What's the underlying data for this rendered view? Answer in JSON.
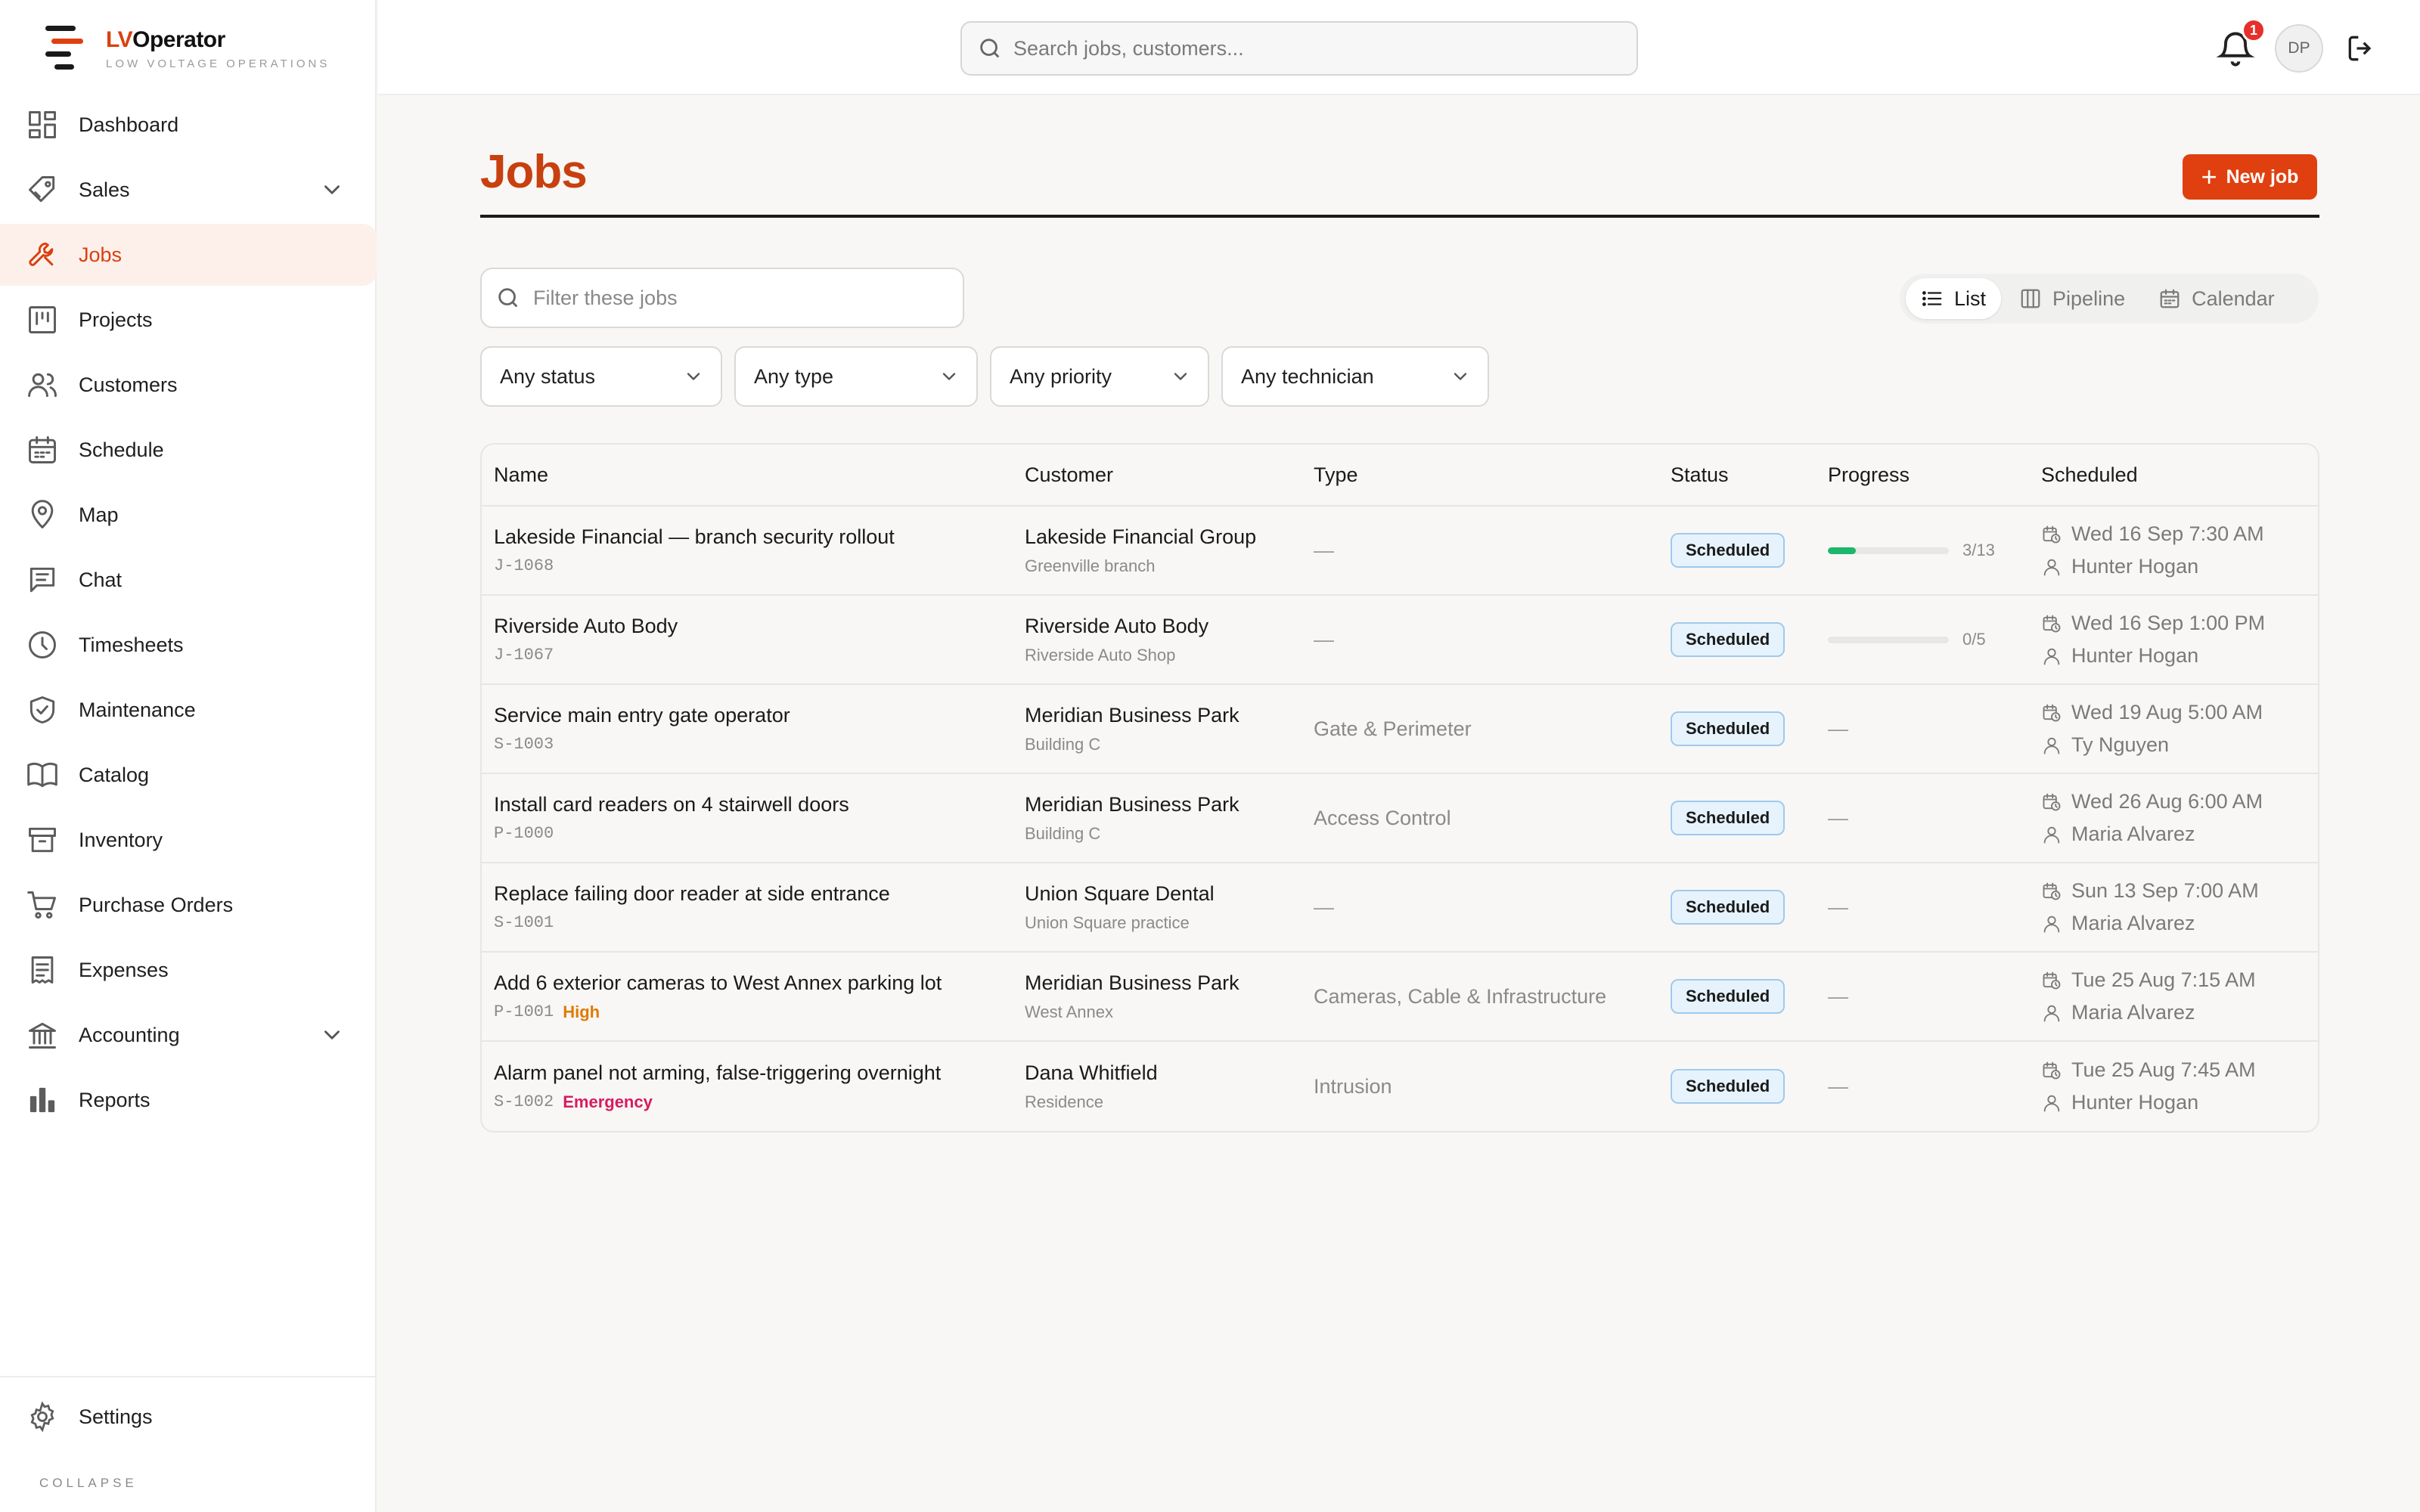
{
  "app": {
    "brand_lv": "LV",
    "brand_rest": "Operator",
    "tagline": "LOW VOLTAGE OPERATIONS"
  },
  "nav": [
    {
      "label": "Dashboard",
      "icon": "dashboard-icon"
    },
    {
      "label": "Sales",
      "icon": "tag-icon",
      "expandable": true
    },
    {
      "label": "Jobs",
      "icon": "wrench-icon",
      "active": true
    },
    {
      "label": "Projects",
      "icon": "kanban-icon"
    },
    {
      "label": "Customers",
      "icon": "users-icon"
    },
    {
      "label": "Schedule",
      "icon": "calendar-icon"
    },
    {
      "label": "Map",
      "icon": "map-pin-icon"
    },
    {
      "label": "Chat",
      "icon": "chat-icon"
    },
    {
      "label": "Timesheets",
      "icon": "clock-icon"
    },
    {
      "label": "Maintenance",
      "icon": "shield-check-icon"
    },
    {
      "label": "Catalog",
      "icon": "book-icon"
    },
    {
      "label": "Inventory",
      "icon": "archive-icon"
    },
    {
      "label": "Purchase Orders",
      "icon": "cart-icon"
    },
    {
      "label": "Expenses",
      "icon": "receipt-icon"
    },
    {
      "label": "Accounting",
      "icon": "bank-icon",
      "expandable": true
    },
    {
      "label": "Reports",
      "icon": "bar-chart-icon"
    }
  ],
  "sidebar_footer": {
    "settings_label": "Settings",
    "collapse_label": "COLLAPSE"
  },
  "topbar": {
    "search_placeholder": "Search jobs, customers...",
    "notification_count": "1",
    "avatar_initials": "DP"
  },
  "page": {
    "title": "Jobs",
    "new_job_label": "New job",
    "filter_placeholder": "Filter these jobs",
    "views": [
      {
        "label": "List",
        "icon": "list-icon",
        "active": true
      },
      {
        "label": "Pipeline",
        "icon": "columns-icon"
      },
      {
        "label": "Calendar",
        "icon": "calendar-icon"
      }
    ],
    "dropdowns": [
      {
        "label": "Any status"
      },
      {
        "label": "Any type"
      },
      {
        "label": "Any priority"
      },
      {
        "label": "Any technician"
      }
    ]
  },
  "table": {
    "columns": [
      "Name",
      "Customer",
      "Type",
      "Status",
      "Progress",
      "Scheduled"
    ],
    "rows": [
      {
        "name": "Lakeside Financial — branch security rollout",
        "code": "J-1068",
        "priority": "",
        "customer": "Lakeside Financial Group",
        "location": "Greenville branch",
        "type": "—",
        "status": "Scheduled",
        "progress": "3/13",
        "progress_fraction": 0.23,
        "date": "Wed 16 Sep 7:30 AM",
        "tech": "Hunter Hogan"
      },
      {
        "name": "Riverside Auto Body",
        "code": "J-1067",
        "priority": "",
        "customer": "Riverside Auto Body",
        "location": "Riverside Auto Shop",
        "type": "—",
        "status": "Scheduled",
        "progress": "0/5",
        "progress_fraction": 0,
        "date": "Wed 16 Sep 1:00 PM",
        "tech": "Hunter Hogan"
      },
      {
        "name": "Service main entry gate operator",
        "code": "S-1003",
        "priority": "",
        "customer": "Meridian Business Park",
        "location": "Building C",
        "type": "Gate & Perimeter",
        "status": "Scheduled",
        "progress": "—",
        "date": "Wed 19 Aug 5:00 AM",
        "tech": "Ty Nguyen"
      },
      {
        "name": "Install card readers on 4 stairwell doors",
        "code": "P-1000",
        "priority": "",
        "customer": "Meridian Business Park",
        "location": "Building C",
        "type": "Access Control",
        "status": "Scheduled",
        "progress": "—",
        "date": "Wed 26 Aug 6:00 AM",
        "tech": "Maria Alvarez"
      },
      {
        "name": "Replace failing door reader at side entrance",
        "code": "S-1001",
        "priority": "",
        "customer": "Union Square Dental",
        "location": "Union Square practice",
        "type": "—",
        "status": "Scheduled",
        "progress": "—",
        "date": "Sun 13 Sep 7:00 AM",
        "tech": "Maria Alvarez"
      },
      {
        "name": "Add 6 exterior cameras to West Annex parking lot",
        "code": "P-1001",
        "priority": "High",
        "customer": "Meridian Business Park",
        "location": "West Annex",
        "type": "Cameras, Cable & Infrastructure",
        "status": "Scheduled",
        "progress": "—",
        "date": "Tue 25 Aug 7:15 AM",
        "tech": "Maria Alvarez"
      },
      {
        "name": "Alarm panel not arming, false-triggering overnight",
        "code": "S-1002",
        "priority": "Emergency",
        "customer": "Dana Whitfield",
        "location": "Residence",
        "type": "Intrusion",
        "status": "Scheduled",
        "progress": "—",
        "date": "Tue 25 Aug 7:45 AM",
        "tech": "Hunter Hogan"
      }
    ]
  },
  "colors": {
    "brand": "#d9400f",
    "success": "#1db66c",
    "status_scheduled_bg": "#e6f3fd",
    "status_scheduled_border": "#9fcaec",
    "priority_high": "#e07a00",
    "priority_emergency": "#d81b60",
    "notification": "#e5302b"
  }
}
